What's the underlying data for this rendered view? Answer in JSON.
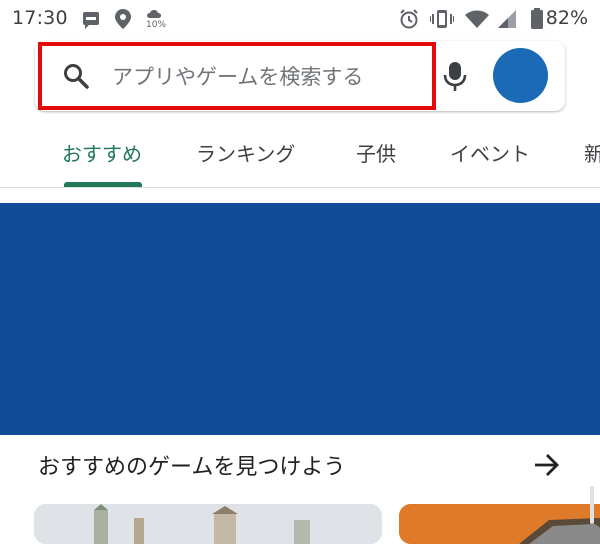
{
  "status_bar": {
    "time": "17:30",
    "weather_pct": "10%",
    "battery": "82%",
    "icons": [
      "app-notification-icon",
      "location-pin-icon",
      "weather-icon",
      "alarm-icon",
      "vibrate-icon",
      "wifi-icon",
      "signal-icon",
      "battery-icon"
    ]
  },
  "search": {
    "placeholder": "アプリやゲームを検索する",
    "highlight_color": "#e20a0a"
  },
  "tabs": [
    {
      "label": "おすすめ",
      "active": true
    },
    {
      "label": "ランキング",
      "active": false
    },
    {
      "label": "子供",
      "active": false
    },
    {
      "label": "イベント",
      "active": false
    },
    {
      "label": "新",
      "active": false
    }
  ],
  "colors": {
    "accent": "#1f7a56",
    "banner": "#124b95",
    "avatar": "#1a6ab5"
  },
  "section": {
    "title": "おすすめのゲームを見つけよう",
    "more_icon": "arrow-right-icon"
  }
}
